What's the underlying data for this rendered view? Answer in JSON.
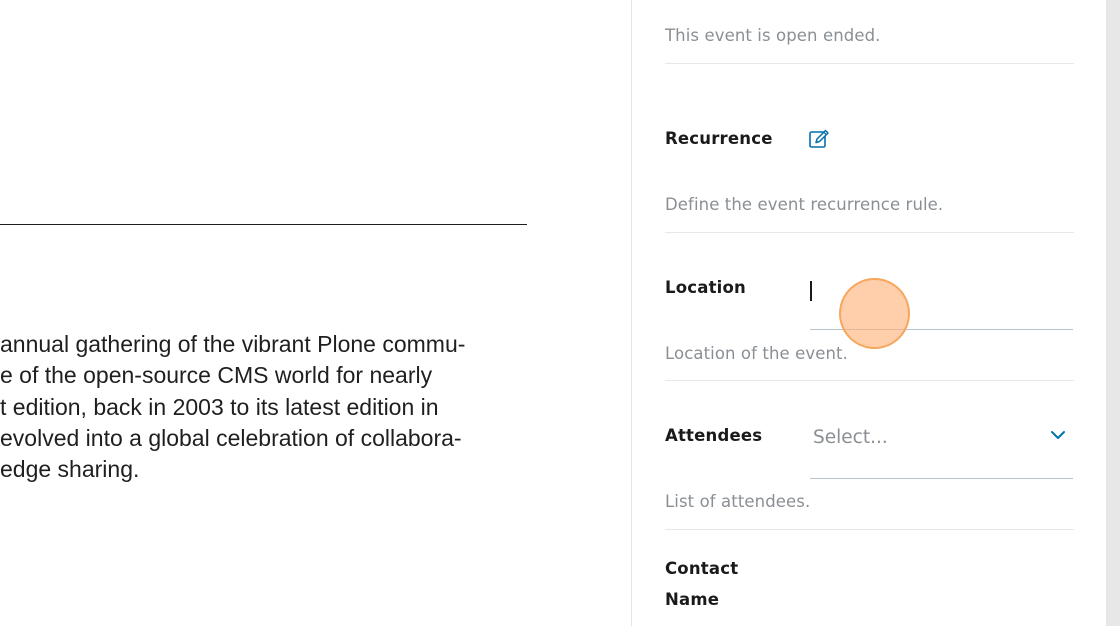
{
  "editor": {
    "body_lines": [
      " annual gathering of the vibrant Plone commu-",
      "e of the open-source CMS world for nearly",
      "t edition, back in 2003 to its latest edition in",
      "evolved into a global celebration of collabora-",
      "edge sharing."
    ]
  },
  "sidebar": {
    "open_end": {
      "help": "This event is open ended."
    },
    "recurrence": {
      "label": "Recurrence",
      "edit_icon": "edit-pencil-square-icon",
      "help": "Define the event recurrence rule."
    },
    "location": {
      "label": "Location",
      "value": "",
      "help": "Location of the event."
    },
    "attendees": {
      "label": "Attendees",
      "placeholder": "Select...",
      "chevron_icon": "chevron-down-icon",
      "help": "List of attendees."
    },
    "contact_name": {
      "label_line1": "Contact",
      "label_line2": "Name"
    }
  },
  "colors": {
    "accent": "#0070ae",
    "help_text": "#8a8f94",
    "divider": "#e6e8ea",
    "click_marker": "#ffb078"
  }
}
